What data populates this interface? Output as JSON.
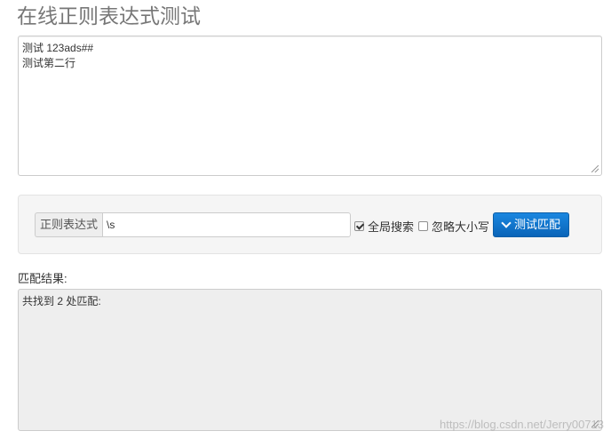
{
  "page": {
    "title": "在线正则表达式测试"
  },
  "source": {
    "text": "测试 123ads##\n测试第二行"
  },
  "controls": {
    "regex_label": "正则表达式",
    "regex_value": "\\s",
    "global_search_label": "全局搜索",
    "global_search_checked": true,
    "ignore_case_label": "忽略大小写",
    "ignore_case_checked": false,
    "test_button_label": "测试匹配",
    "test_button_icon": "chevron-down-icon",
    "accent_color": "#0a64b8"
  },
  "result": {
    "label": "匹配结果:",
    "text": "共找到 2 处匹配:"
  },
  "watermark": "https://blog.csdn.net/Jerry00713"
}
